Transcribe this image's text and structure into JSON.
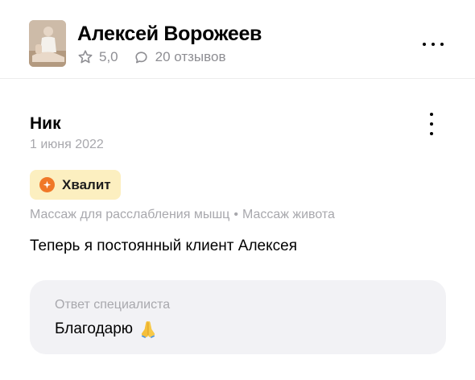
{
  "specialist": {
    "name": "Алексей Ворожеев",
    "rating": "5,0",
    "reviews_count": "20 отзывов"
  },
  "review": {
    "author": "Ник",
    "date": "1 июня 2022",
    "badge": "Хвалит",
    "services": [
      "Массаж для расслабления мышц",
      "Массаж живота"
    ],
    "separator": "•",
    "text": "Теперь я постоянный клиент Алексея"
  },
  "reply": {
    "label": "Ответ специалиста",
    "text": "Благодарю",
    "emoji": "folded-hands-icon"
  },
  "icons": {
    "rating": "star-outline-icon",
    "reviews": "speech-bubble-icon",
    "header_menu": "more-horizontal-icon",
    "review_menu": "more-vertical-icon",
    "badge": "praise-icon"
  },
  "colors": {
    "badge_bg": "#fcefc0",
    "badge_icon": "#f07828",
    "muted_text": "#a8a8ad",
    "reply_bg": "#f2f2f5"
  }
}
